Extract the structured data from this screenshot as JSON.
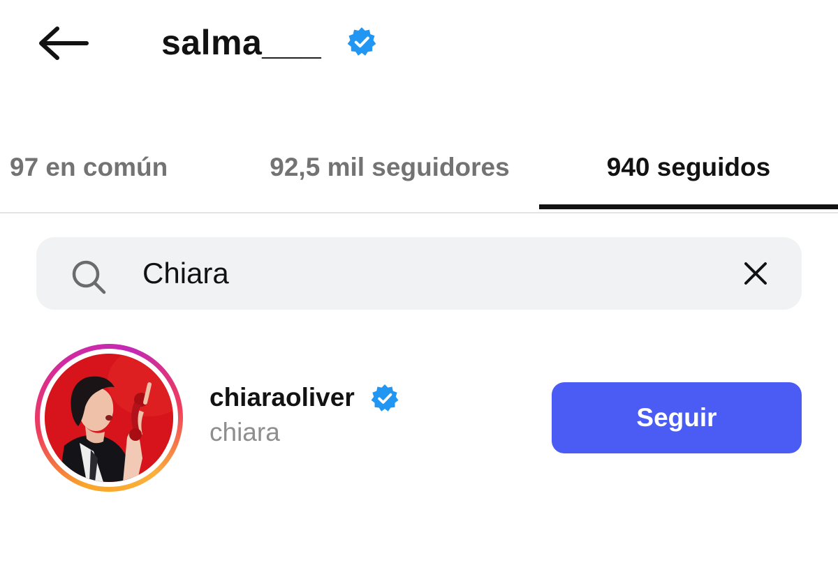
{
  "header": {
    "title": "salma___",
    "back_icon": "arrow-left-icon",
    "verified_icon": "verified-badge-icon"
  },
  "tabs": [
    {
      "label": "97 en común",
      "active": false
    },
    {
      "label": "92,5 mil seguidores",
      "active": false
    },
    {
      "label": "940 seguidos",
      "active": true
    }
  ],
  "search": {
    "value": "Chiara",
    "placeholder": "Buscar",
    "search_icon": "search-icon",
    "clear_icon": "close-icon"
  },
  "results": [
    {
      "username": "chiaraoliver",
      "full_name": "chiara",
      "verified": true,
      "story_ring": true,
      "button_label": "Seguir"
    }
  ],
  "colors": {
    "accent": "#4b5cf5",
    "verified": "#2196f3",
    "text_primary": "#121212",
    "text_secondary": "#737373",
    "search_bg": "#f1f2f4"
  }
}
